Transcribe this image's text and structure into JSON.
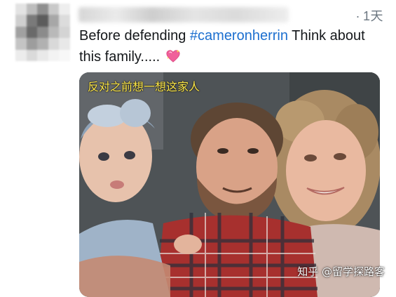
{
  "tweet": {
    "time_dot": "·",
    "time": "1天",
    "text_before": "Before defending ",
    "hashtag": "#cameronherrin",
    "text_after": " Think about this family.....",
    "emoji": "sparkling-heart-icon"
  },
  "photo": {
    "caption": "反对之前想一想这家人"
  },
  "watermark": {
    "text": "知乎 @留学探路客"
  },
  "colors": {
    "hashtag": "#1c6fcf",
    "text": "#14171a",
    "meta": "#6b7680",
    "caption": "#ffe94a"
  }
}
